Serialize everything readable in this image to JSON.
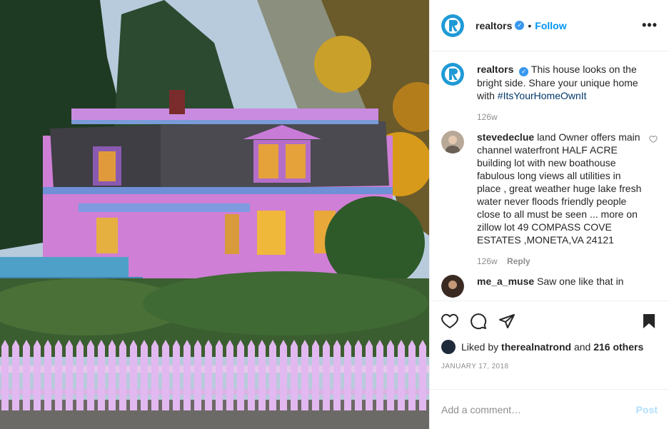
{
  "post": {
    "photo_alt": "Pink and purple Victorian house with white picket fence",
    "icon": "house-photo"
  },
  "header": {
    "username": "realtors",
    "verified_icon": "verified-badge-icon",
    "separator": "•",
    "follow_label": "Follow",
    "more_label": "•••"
  },
  "caption": {
    "username": "realtors",
    "text": "This house looks on the bright side. Share your unique home with ",
    "hashtag": "#ItsYourHomeOwnIt",
    "time": "126w"
  },
  "comments": [
    {
      "username": "stevedeclue",
      "text": "land Owner offers main channel waterfront HALF ACRE building lot with new boathouse fabulous long views all utilities in place , great weather huge lake fresh water never floods friendly people close to all must be seen ... more on zillow lot 49 COMPASS COVE ESTATES ,MONETA,VA 24121",
      "time": "126w",
      "reply_label": "Reply"
    },
    {
      "username": "me_a_muse",
      "text": "Saw one like that in"
    }
  ],
  "actions": {
    "liked_by_prefix": "Liked by",
    "liked_by_user": "therealnatrond",
    "liked_by_and": "and",
    "others": "216 others",
    "date": "JANUARY 17, 2018"
  },
  "add_comment": {
    "placeholder": "Add a comment…",
    "post_label": "Post"
  },
  "colors": {
    "accent": "#0095f6",
    "verified": "#3897f0",
    "muted": "#8e8e8e",
    "post_disabled": "#b2dffc",
    "logo_blue": "#1f9ad6"
  }
}
